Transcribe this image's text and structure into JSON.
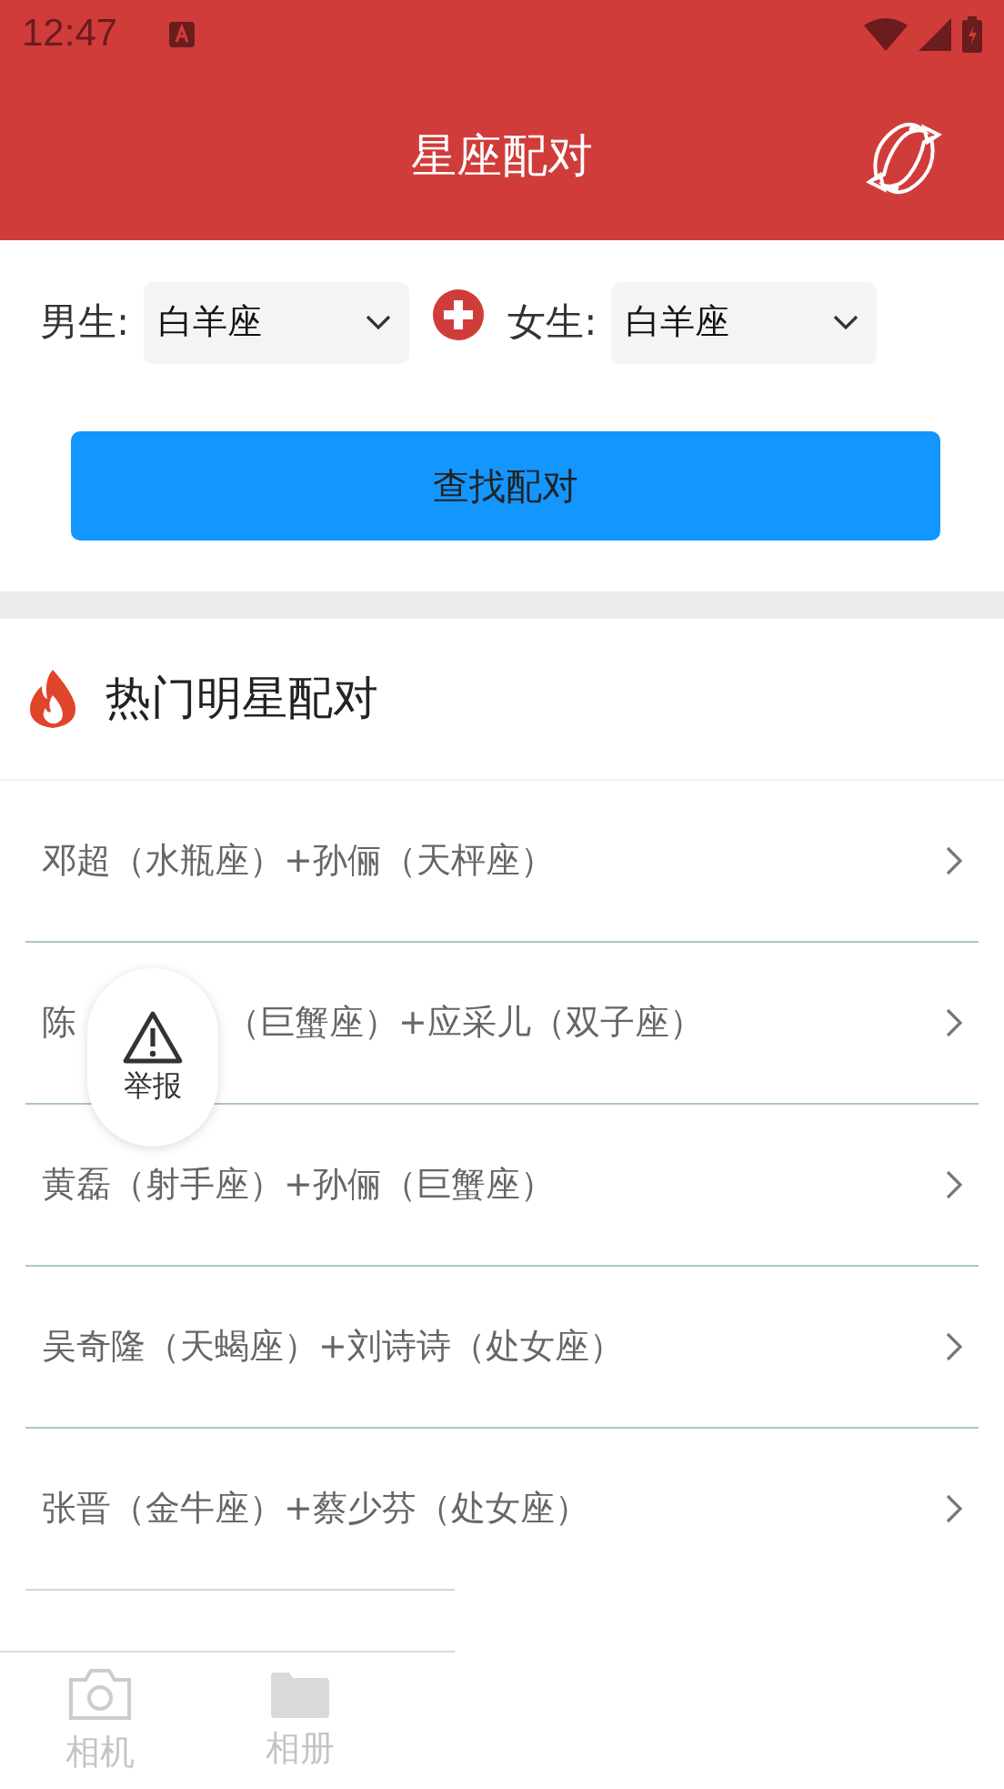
{
  "status_bar": {
    "time": "12:47"
  },
  "header": {
    "title": "星座配对"
  },
  "form": {
    "male_label": "男生:",
    "male_value": "白羊座",
    "female_label": "女生:",
    "female_value": "白羊座",
    "button": "查找配对"
  },
  "hot": {
    "title": "热门明星配对",
    "rows": [
      {
        "segments": [
          "邓超（水瓶座）+孙俪（天枰座）"
        ]
      },
      {
        "segments": [
          "陈",
          "（巨蟹座）+应采儿（双子座）"
        ]
      },
      {
        "segments": [
          "黄磊（射手座）+孙俪（巨蟹座）"
        ]
      },
      {
        "segments": [
          "吴奇隆（天蝎座）+刘诗诗（处女座）"
        ]
      },
      {
        "segments": [
          "张晋（金牛座）+蔡少芬（处女座）"
        ]
      }
    ]
  },
  "report_button": {
    "label": "举报"
  },
  "tab_bar": [
    {
      "kind": "camera",
      "label": "相机",
      "selected": false
    },
    {
      "kind": "folder",
      "label": "相册",
      "selected": false
    }
  ]
}
